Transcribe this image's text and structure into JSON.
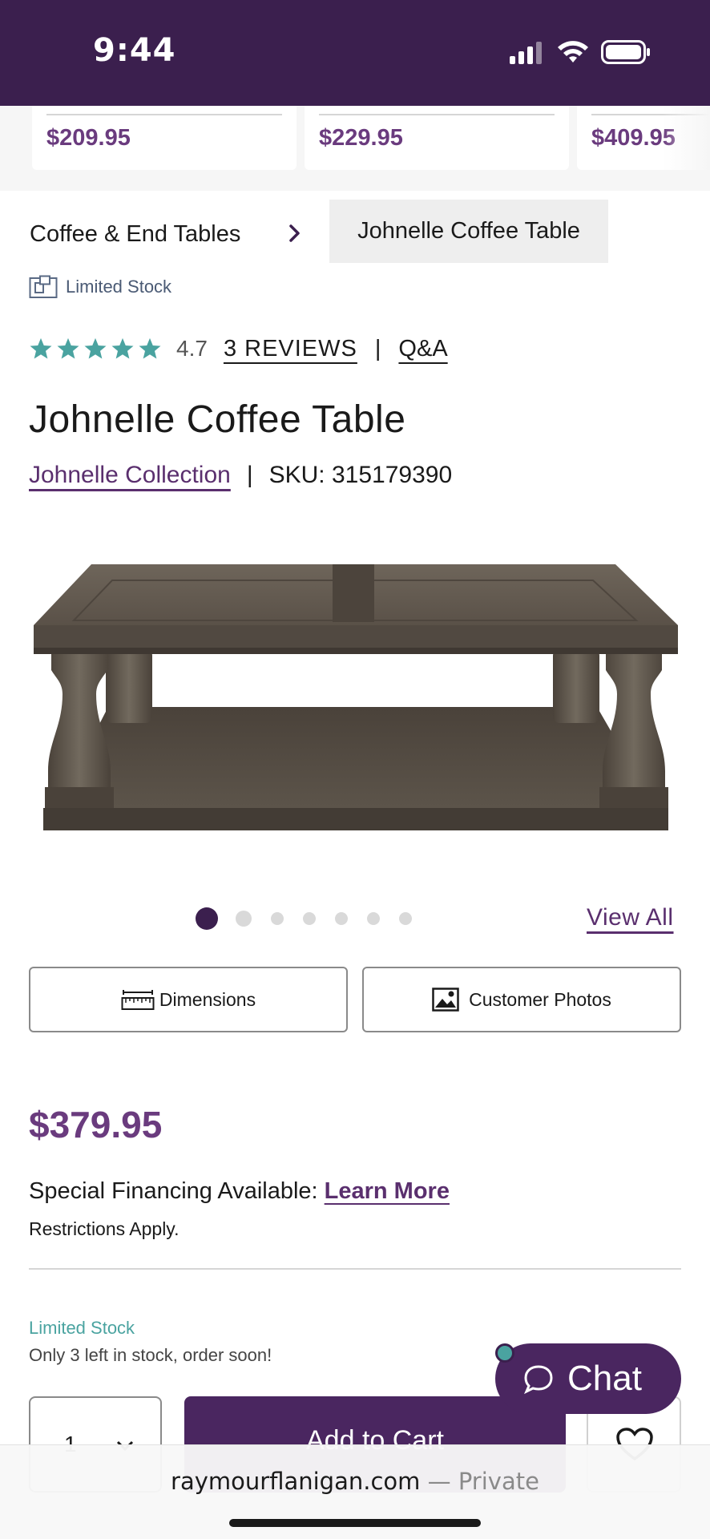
{
  "status_bar": {
    "time": "9:44"
  },
  "related_products": {
    "prices": [
      "$209.95",
      "$229.95",
      "$409.95"
    ]
  },
  "breadcrumb": {
    "parent": "Coffee & End Tables",
    "current": "Johnelle Coffee Table"
  },
  "availability": {
    "top_label": "Limited Stock",
    "label": "Limited Stock",
    "note": "Only 3 left in stock, order soon!"
  },
  "rating": {
    "stars": 5,
    "value": "4.7",
    "reviews_link": "3 REVIEWS",
    "separator": "|",
    "qa_link": "Q&A",
    "star_color": "#4aa3a0"
  },
  "product": {
    "title": "Johnelle Coffee Table",
    "collection_link": "Johnelle Collection",
    "separator": "|",
    "sku": "SKU: 315179390",
    "price": "$379.95"
  },
  "gallery": {
    "dot_count": 7,
    "active_index": 0,
    "view_all": "View All"
  },
  "actions": {
    "dimensions": "Dimensions",
    "customer_photos": "Customer Photos",
    "quantity": "1",
    "add_to_cart": "Add to Cart"
  },
  "financing": {
    "text": "Special Financing Available: ",
    "link": "Learn More",
    "restrictions": "Restrictions Apply."
  },
  "chat": {
    "label": "Chat"
  },
  "browser": {
    "domain": "raymourflanigan.com",
    "suffix": " — Private"
  },
  "colors": {
    "brand_purple": "#3b1f4e",
    "price_purple": "#6a3b7e",
    "teal": "#4aa3a0"
  }
}
